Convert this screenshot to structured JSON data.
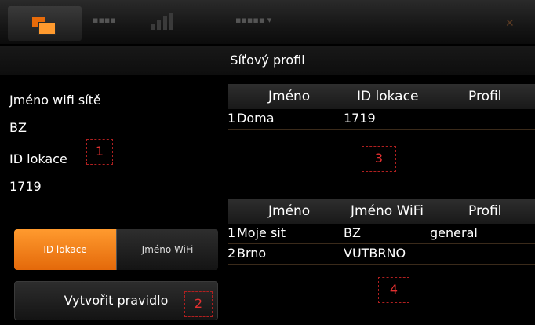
{
  "window": {
    "title": "Síťový profil"
  },
  "left": {
    "wifi_name_label": "Jméno wifi sítě",
    "wifi_name_value": "BZ",
    "location_id_label": "ID lokace",
    "location_id_value": "1719"
  },
  "markers": [
    "1",
    "2",
    "3",
    "4"
  ],
  "location_table": {
    "headers": [
      "Jméno",
      "ID lokace",
      "Profil"
    ],
    "rows": [
      {
        "index": "1",
        "name": "Doma",
        "id": "1719",
        "profile": ""
      }
    ]
  },
  "wifi_table": {
    "headers": [
      "Jméno",
      "Jméno WiFi",
      "Profil"
    ],
    "rows": [
      {
        "index": "1",
        "name": "Moje sit",
        "wifi": "BZ",
        "profile": "general"
      },
      {
        "index": "2",
        "name": "Brno",
        "wifi": "VUTBRNO",
        "profile": ""
      }
    ]
  },
  "segmented": {
    "option_location": "ID lokace",
    "option_wifi": "Jméno WiFi",
    "selected": "ID lokace"
  },
  "create_rule_label": "Vytvořit pravidlo",
  "colors": {
    "accent": "#f07d14",
    "marker": "#e23030",
    "background": "#000000"
  }
}
